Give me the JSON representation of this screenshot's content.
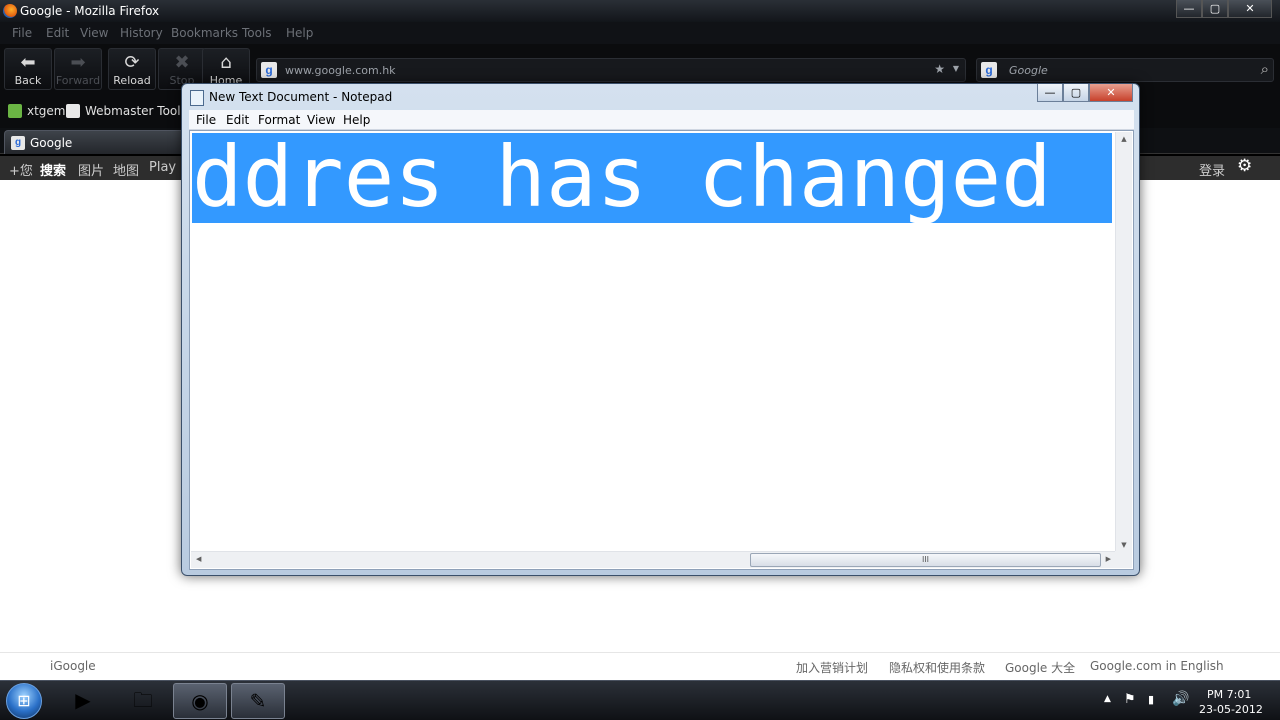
{
  "firefox": {
    "title": "Google - Mozilla Firefox",
    "menu": [
      "File",
      "Edit",
      "View",
      "History",
      "Bookmarks",
      "Tools",
      "Help"
    ],
    "nav": {
      "back": "Back",
      "forward": "Forward",
      "reload": "Reload",
      "stop": "Stop",
      "home": "Home"
    },
    "url": "www.google.com.hk",
    "search_placeholder": "Google",
    "bookmarks": [
      "xtgem",
      "Webmaster Tools"
    ],
    "tab": "Google"
  },
  "google_bar": {
    "items": [
      "+您",
      "搜索",
      "图片",
      "地图",
      "Play"
    ],
    "sign_in": "登录"
  },
  "google_footer": {
    "left": "iGoogle",
    "links": [
      "加入营销计划",
      "隐私权和使用条款",
      "Google 大全",
      "Google.com in English"
    ]
  },
  "notepad": {
    "title": "New Text Document - Notepad",
    "menu": [
      "File",
      "Edit",
      "Format",
      "View",
      "Help"
    ],
    "content": "ddres has changed",
    "hscroll_grip": "III"
  },
  "taskbar": {
    "time": "PM 7:01",
    "date": "23-05-2012"
  },
  "window_buttons": {
    "minimize": "—",
    "maximize": "▢",
    "close": "✕"
  },
  "icons": {
    "back": "arrow-left-icon",
    "forward": "arrow-right-icon",
    "reload": "reload-icon",
    "stop": "stop-icon",
    "home": "home-icon",
    "search": "search-icon",
    "settings": "gear-icon"
  }
}
